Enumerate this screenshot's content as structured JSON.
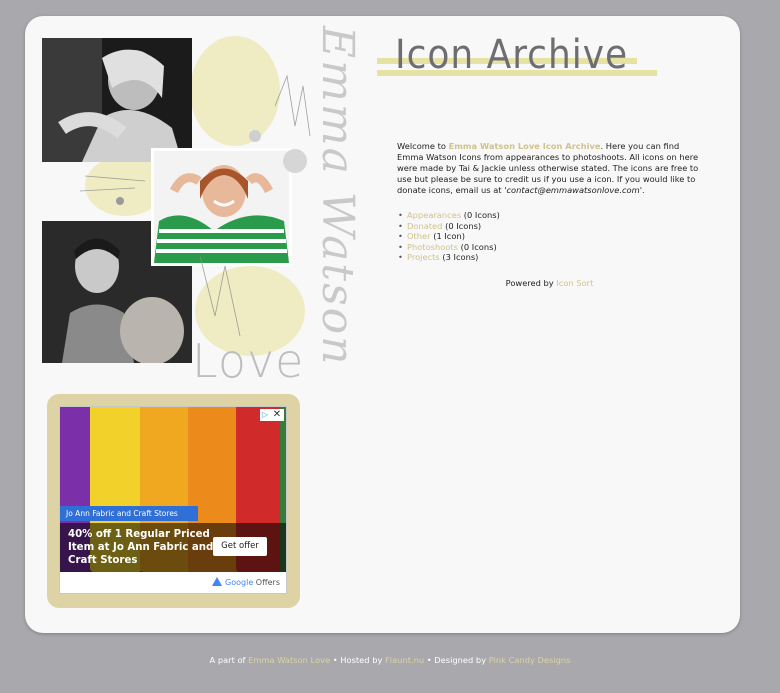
{
  "header": {
    "title": "Icon Archive"
  },
  "collage": {
    "vertical_name": "Emma Watson",
    "love_word": "Love"
  },
  "intro": {
    "welcome_prefix": "Welcome to ",
    "archive_link": "Emma Watson Love Icon Archive",
    "body": ". Here you can find Emma Watson Icons from appearances to photoshoots. All icons on here were made by Tai & Jackie unless otherwise stated. The icons are free to use but please be sure to credit us if you use a icon. If you would like to donate icons, email us at ",
    "email": "contact@emmawatsonlove.com",
    "suffix": "."
  },
  "categories": [
    {
      "name": "Appearances",
      "count": "(0 Icons)"
    },
    {
      "name": "Donated",
      "count": "(0 Icons)"
    },
    {
      "name": "Other",
      "count": "(1 Icon)"
    },
    {
      "name": "Photoshoots",
      "count": "(0 Icons)"
    },
    {
      "name": "Projects",
      "count": "(3 Icons)"
    }
  ],
  "powered": {
    "prefix": "Powered by ",
    "link": "Icon Sort"
  },
  "ad": {
    "tag": "Jo Ann Fabric and Craft Stores",
    "headline": "40% off 1 Regular Priced Item at Jo Ann Fabric and Craft Stores",
    "cta": "Get offer",
    "close_glyph": "✕",
    "choice_glyph": "▷",
    "google": "Google",
    "offers": " Offers"
  },
  "footer": {
    "part_of": "A part of ",
    "site_link": "Emma Watson Love",
    "hosted_sep": " • Hosted by ",
    "host_link": "Flaunt.nu",
    "designed_sep": " • Designed by ",
    "designer_link": "Pink Candy Designs"
  },
  "colors": {
    "accent": "#cfc28a",
    "ad_frame": "#ddd3a4",
    "page_bg": "#a9a8ad"
  }
}
